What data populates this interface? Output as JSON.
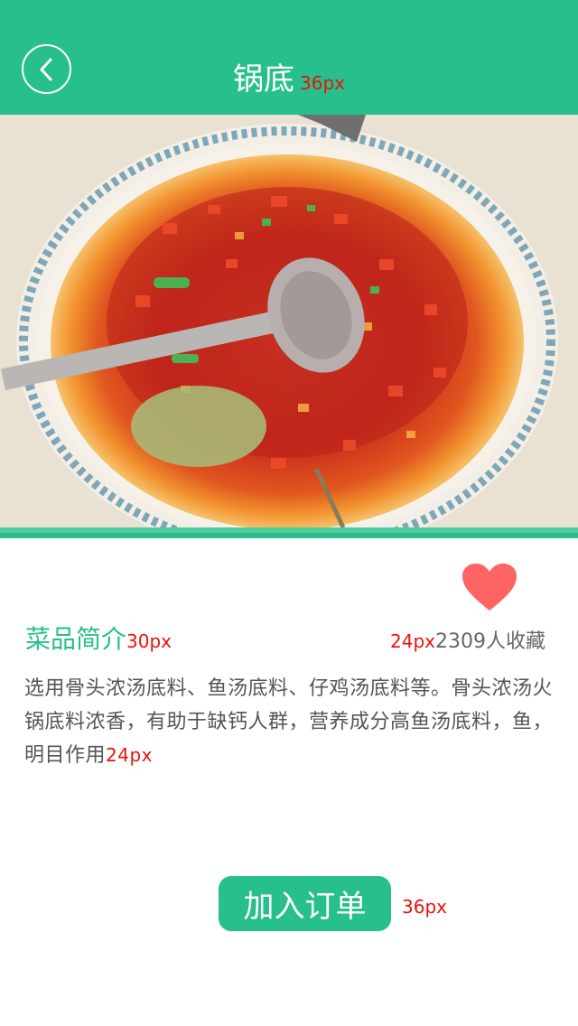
{
  "header": {
    "title": "锅底",
    "title_annotation": "36px",
    "background": "#27bf8b",
    "back_icon": "chevron-left-icon"
  },
  "food_image": {
    "description_icon": "hotpot-photo"
  },
  "intro": {
    "title": "菜品简介",
    "title_annotation": "30px",
    "favorite_annotation": "24px",
    "favorite_count": "2309人收藏",
    "favorite_icon": "heart-icon",
    "favorite_color": "#ff6464"
  },
  "description": {
    "text": "选用骨头浓汤底料、鱼汤底料、仔鸡汤底料等。骨头浓汤火锅底料浓香，有助于缺钙人群，营养成分高鱼汤底料，鱼，明目作用",
    "annotation": "24px"
  },
  "order": {
    "button_label": "加入订单",
    "annotation": "36px",
    "color": "#27bf8b"
  },
  "annotation_color": "#e8130b"
}
